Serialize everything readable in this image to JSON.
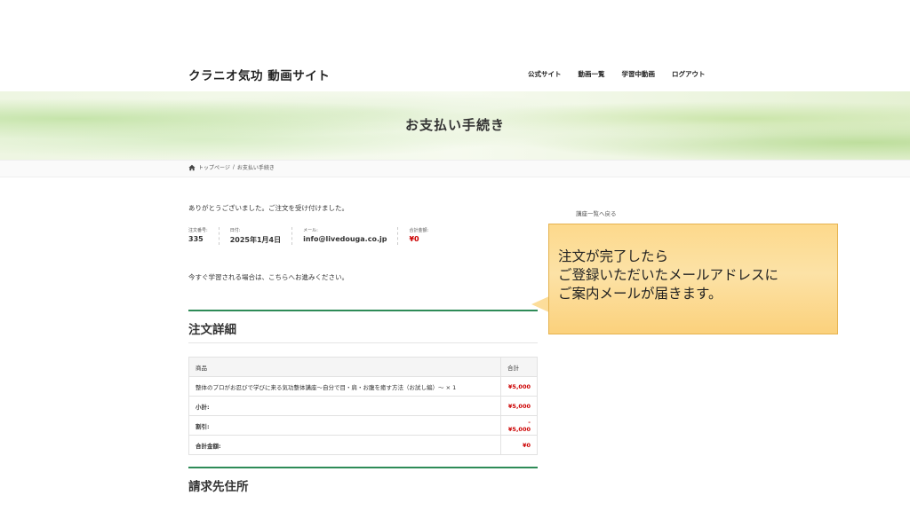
{
  "header": {
    "site_title": "クラニオ気功 動画サイト",
    "nav": [
      "公式サイト",
      "動画一覧",
      "学習中動画",
      "ログアウト"
    ]
  },
  "hero": {
    "title": "お支払い手続き"
  },
  "breadcrumb": {
    "home": "トップページ",
    "separator": "/",
    "current": "お支払い手続き"
  },
  "main": {
    "thanks": "ありがとうございました。ご注文を受け付けました。",
    "overview": [
      {
        "label": "注文番号:",
        "value": "335"
      },
      {
        "label": "日付:",
        "value": "2025年1月4日"
      },
      {
        "label": "メール:",
        "value": "info@livedouga.co.jp"
      },
      {
        "label": "合計金額:",
        "value": "¥0"
      }
    ],
    "continue_text": "今すぐ学習される場合は、こちらへお進みください。",
    "order_details_title": "注文詳細",
    "table": {
      "headers": [
        "商品",
        "合計"
      ],
      "item": {
        "name": "整体のプロがお忍びで学びに来る気功整体講座〜自分で目・肩・お腹を癒す方法（お試し編）〜 × 1",
        "amount": "¥5,000"
      },
      "subtotal": {
        "label": "小計:",
        "amount": "¥5,000"
      },
      "discount": {
        "label": "割引:",
        "amount": "-¥5,000"
      },
      "total": {
        "label": "合計金額:",
        "amount": "¥0"
      }
    },
    "billing_title": "請求先住所"
  },
  "sidebar": {
    "back_link": "講座一覧へ戻る"
  },
  "callout": {
    "lines": [
      "注文が完了したら",
      "ご登録いただいたメールアドレスに",
      "ご案内メールが届きます。"
    ]
  },
  "colors": {
    "accent_green": "#2e8b57",
    "price_red": "#cc0000",
    "callout_bg": "#fcdd9a"
  }
}
